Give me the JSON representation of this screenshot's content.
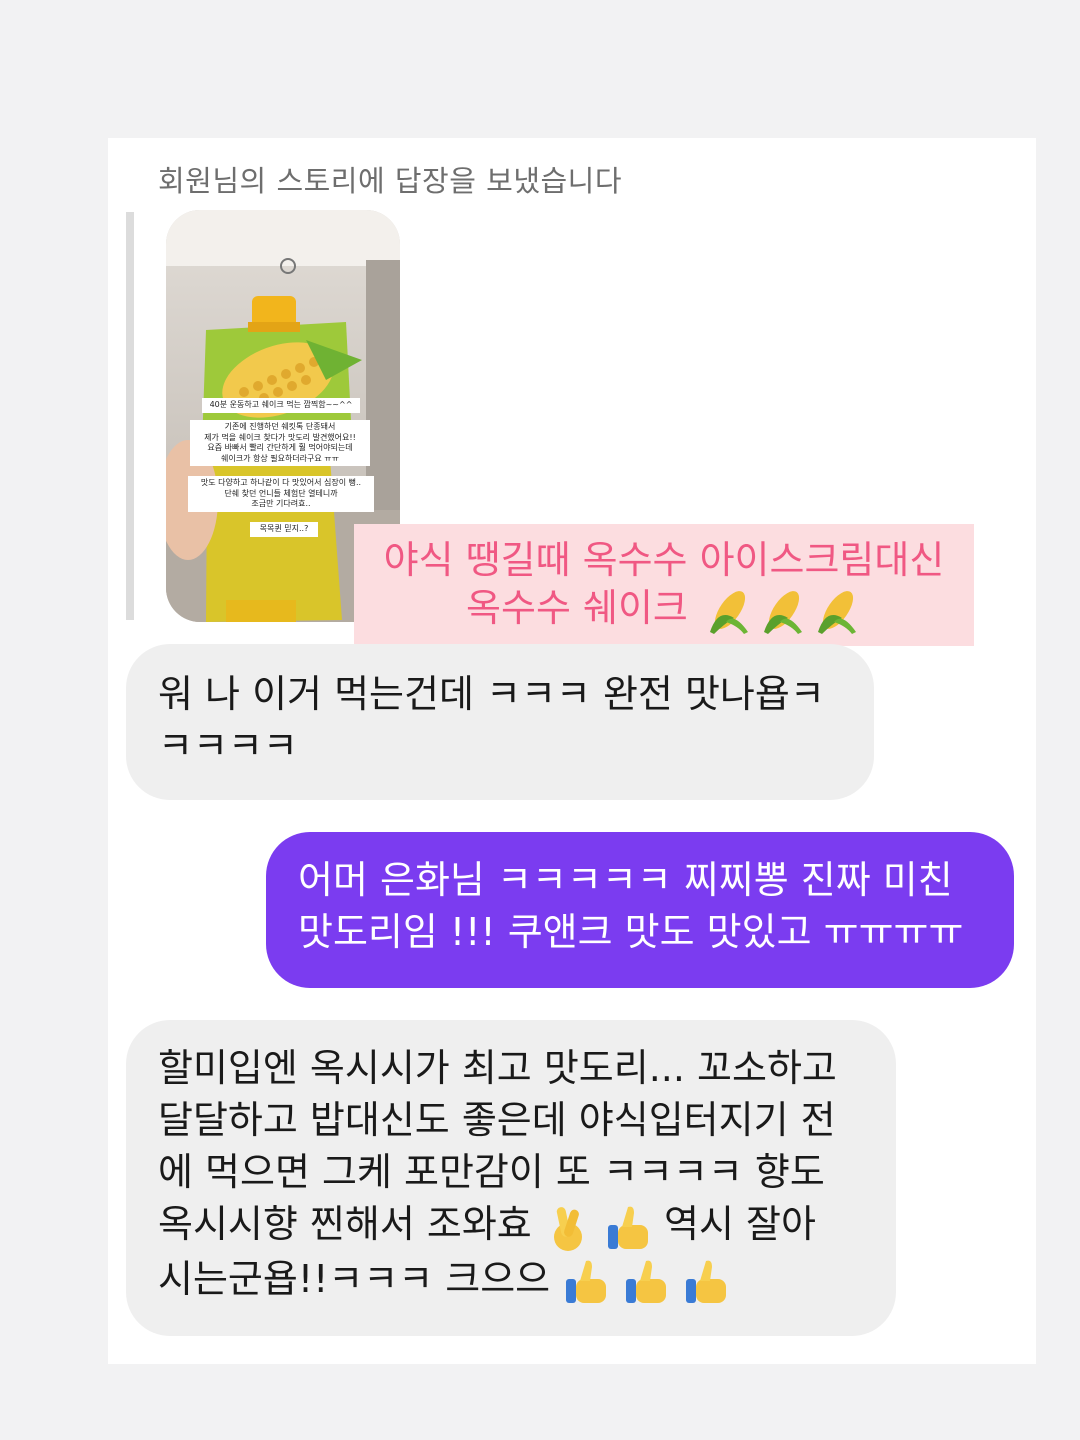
{
  "reply_header": "회원님의 스토리에 답장을 보냈습니다",
  "story": {
    "stickers": [
      "40분 운동하고 쉐이크 먹는 깜찍함~~^^",
      "기존에 진행하던 쉐킷톡 단종돼서\n제가 먹을 쉐이크 찾다가 맛도리 발견했어요!!\n요즘 바빠서 빨리 간단하게 훨 먹어야되는데\n쉐이크가 항상 필요하더라구요 ㅠㅠ",
      "맛도 다양하고 하나같이 다 맛있어서 심장이 뻥..\n단쉐 찾던 언니들 체험단 열테니까\n조금만 기다려효..",
      "목목퀸 믿지..?"
    ],
    "caption_line1": "야식 땡길때 옥수수 아이스크림대신",
    "caption_line2": "옥수수 쉐이크",
    "caption_emoji": "corn-emoji ×3"
  },
  "messages": [
    {
      "direction": "received",
      "lines": [
        "워 나 이거 먹는건데 ㅋㅋㅋ 완전 맛나욥ㅋ",
        "ㅋㅋㅋㅋ"
      ]
    },
    {
      "direction": "sent",
      "lines": [
        "어머 은화님 ㅋㅋㅋㅋㅋ 찌찌뽕 진짜 미친",
        "맛도리임 !!! 쿠앤크 맛도 맛있고 ㅠㅠㅠㅠ"
      ]
    },
    {
      "direction": "received",
      "lines": [
        "할미입엔 옥시시가 최고 맛도리... 꼬소하고",
        "달달하고 밥대신도 좋은데 야식입터지기 전",
        "에 먹으면 그케 포만감이 또 ㅋㅋㅋㅋ 향도",
        "옥시시향 찐해서 조와효",
        "역시 잘아",
        "시는군욥!!ㅋㅋㅋ 크으으"
      ]
    }
  ],
  "colors": {
    "sent_bubble": "#7b3cf0",
    "received_bubble": "#efefef",
    "caption_bg": "#fcdde0",
    "caption_text": "#f05883"
  }
}
